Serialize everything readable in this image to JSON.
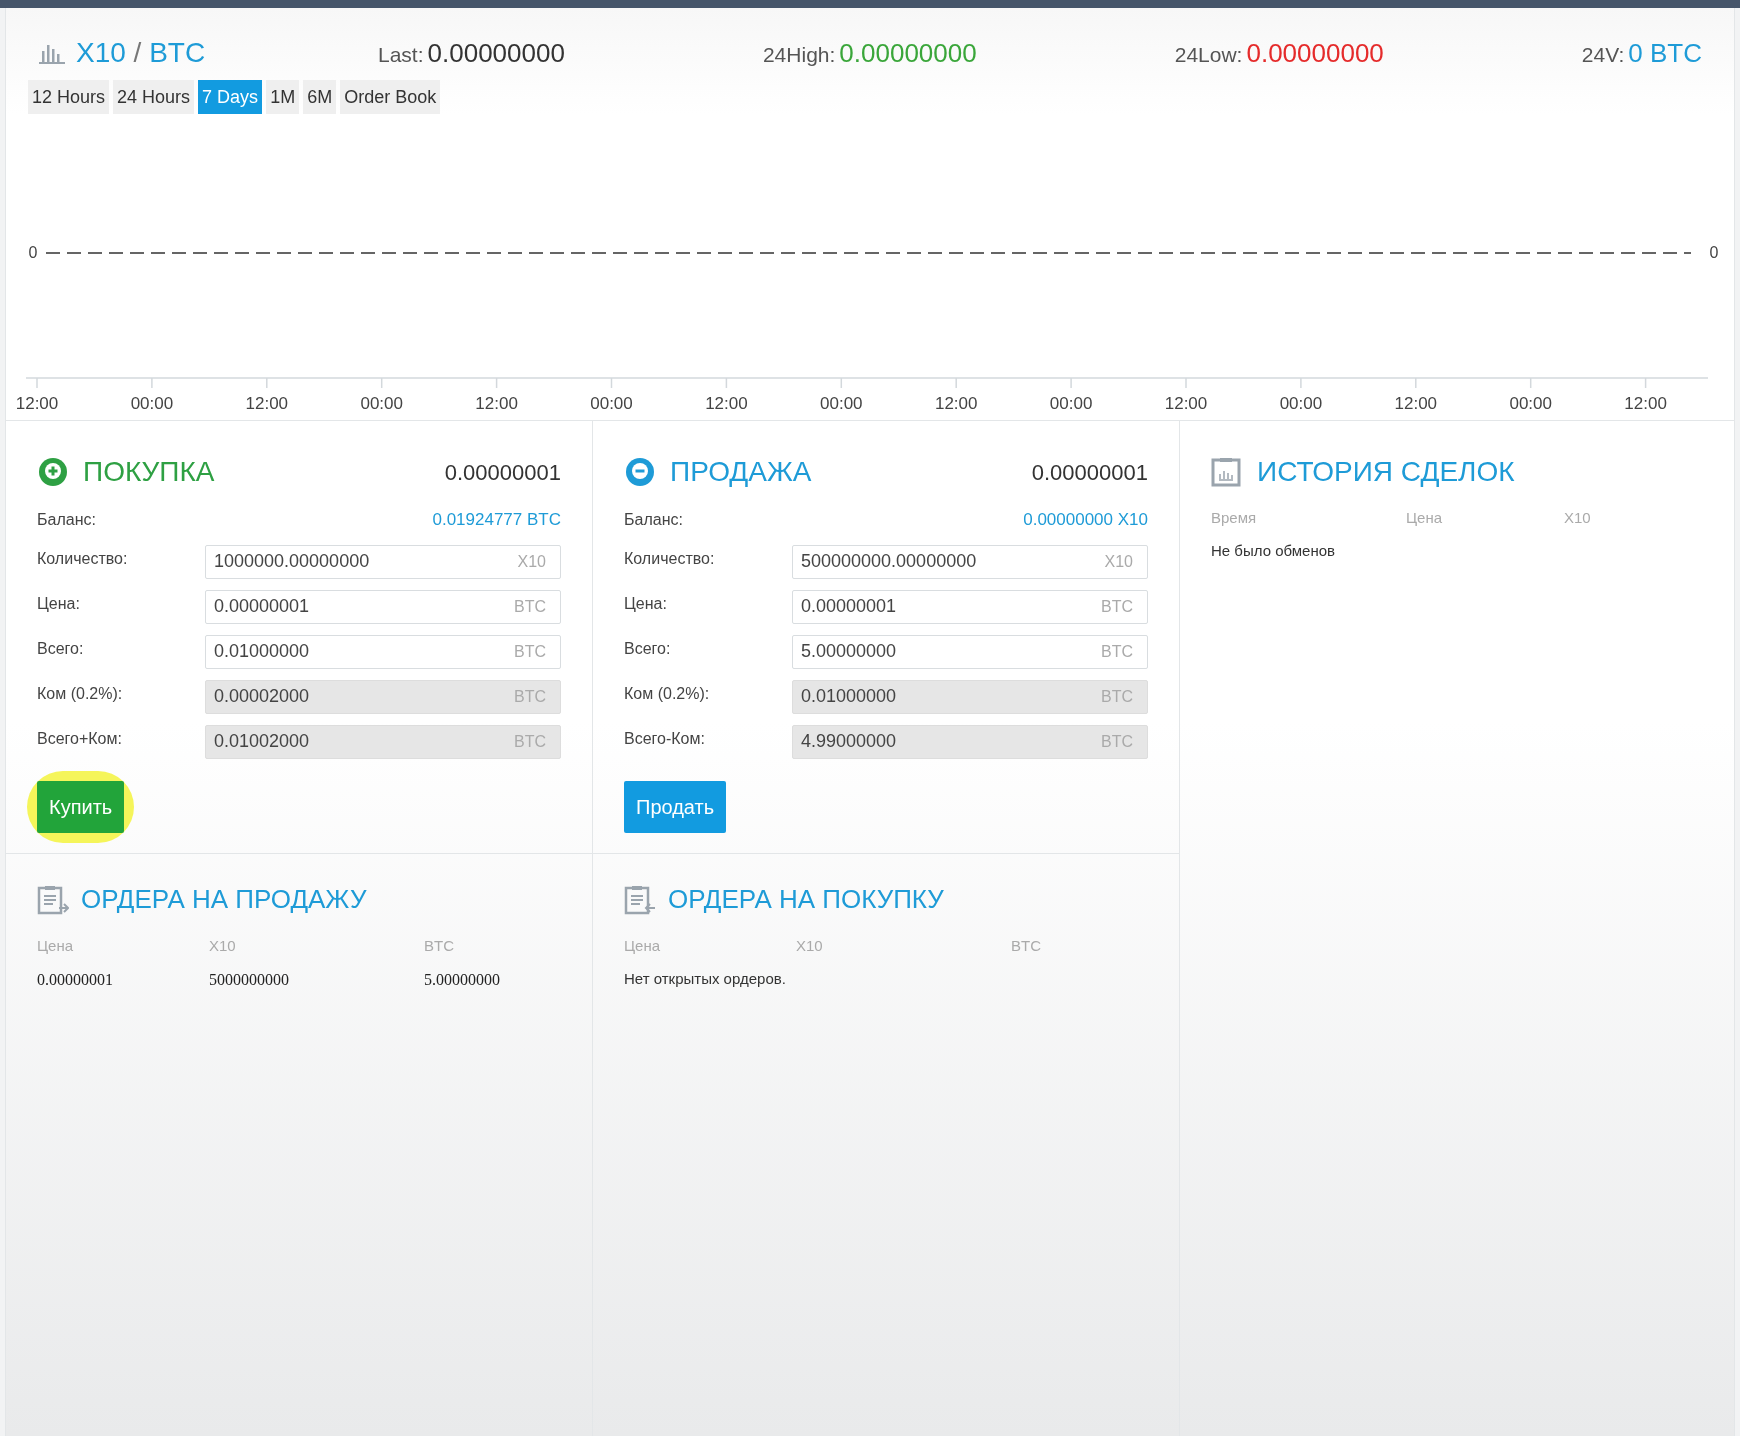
{
  "market": {
    "base": "X10",
    "separator": "/",
    "quote": "BTC",
    "stats": [
      {
        "kind": "last",
        "label": "Last:",
        "value": "0.00000000"
      },
      {
        "kind": "high",
        "label": "24High:",
        "value": "0.00000000"
      },
      {
        "kind": "low",
        "label": "24Low:",
        "value": "0.00000000"
      },
      {
        "kind": "volume",
        "label": "24V:",
        "value": "0 BTC"
      }
    ]
  },
  "ranges": [
    {
      "label": "12 Hours",
      "selected": false
    },
    {
      "label": "24 Hours",
      "selected": false
    },
    {
      "label": "7 Days",
      "selected": true
    },
    {
      "label": "1M",
      "selected": false
    },
    {
      "label": "6M",
      "selected": false
    },
    {
      "label": "Order Book",
      "selected": false
    }
  ],
  "chart": {
    "y_axis_labels": [
      "0",
      "0"
    ],
    "x_axis_labels": [
      "12:00",
      "00:00",
      "12:00",
      "00:00",
      "12:00",
      "00:00",
      "12:00",
      "00:00",
      "12:00",
      "00:00",
      "12:00",
      "00:00",
      "12:00",
      "00:00",
      "12:00"
    ]
  },
  "trade_panels": [
    {
      "kind": "buy",
      "title": "ПОКУПКА",
      "price": "0.00000001",
      "balance_label": "Баланс:",
      "balance": "0.01924777 BTC",
      "button": "Купить",
      "fields": [
        {
          "label": "Количество:",
          "value": "1000000.00000000",
          "unit": "X10",
          "disabled": false
        },
        {
          "label": "Цена:",
          "value": "0.00000001",
          "unit": "BTC",
          "disabled": false
        },
        {
          "label": "Всего:",
          "value": "0.01000000",
          "unit": "BTC",
          "disabled": false
        },
        {
          "label": "Ком (0.2%):",
          "value": "0.00002000",
          "unit": "BTC",
          "disabled": true
        },
        {
          "label": "Всего+Ком:",
          "value": "0.01002000",
          "unit": "BTC",
          "disabled": true
        }
      ]
    },
    {
      "kind": "sell",
      "title": "ПРОДАЖА",
      "price": "0.00000001",
      "balance_label": "Баланс:",
      "balance": "0.00000000 X10",
      "button": "Продать",
      "fields": [
        {
          "label": "Количество:",
          "value": "500000000.00000000",
          "unit": "X10",
          "disabled": false
        },
        {
          "label": "Цена:",
          "value": "0.00000001",
          "unit": "BTC",
          "disabled": false
        },
        {
          "label": "Всего:",
          "value": "5.00000000",
          "unit": "BTC",
          "disabled": false
        },
        {
          "label": "Ком (0.2%):",
          "value": "0.01000000",
          "unit": "BTC",
          "disabled": true
        },
        {
          "label": "Всего-Ком:",
          "value": "4.99000000",
          "unit": "BTC",
          "disabled": true
        }
      ]
    }
  ],
  "history": {
    "title": "ИСТОРИЯ СДЕЛОК",
    "columns": [
      "Время",
      "Цена",
      "X10"
    ],
    "empty": "Не было обменов"
  },
  "order_books": [
    {
      "kind": "sell",
      "title": "ОРДЕРА НА ПРОДАЖУ",
      "columns": [
        "Цена",
        "X10",
        "BTC"
      ],
      "rows": [
        [
          "0.00000001",
          "5000000000",
          "5.00000000"
        ]
      ]
    },
    {
      "kind": "buy",
      "title": "ОРДЕРА НА ПОКУПКУ",
      "columns": [
        "Цена",
        "X10",
        "BTC"
      ],
      "empty": "Нет открытых ордеров."
    }
  ]
}
